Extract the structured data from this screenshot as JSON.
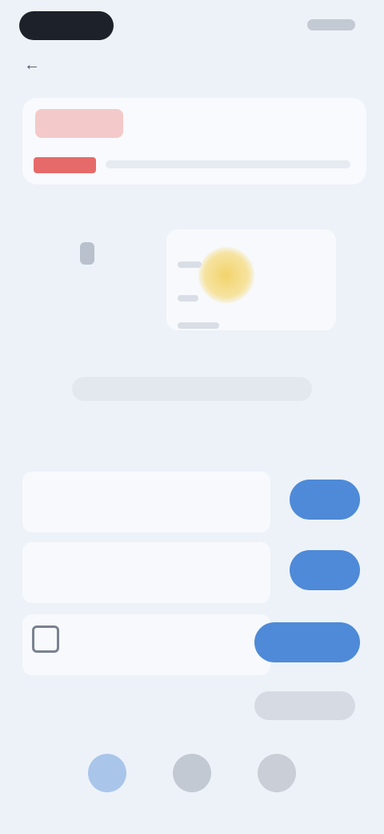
{
  "summary": {
    "title": "",
    "link": ""
  },
  "weather": {
    "left_label": ""
  },
  "section": {
    "title": ""
  },
  "rows": [
    {
      "label": "",
      "sub": "",
      "button": ""
    },
    {
      "label": "",
      "sub": "",
      "button": ""
    },
    {
      "label": "",
      "sub": "",
      "button": ""
    }
  ],
  "footer": {
    "label": "",
    "button": ""
  },
  "icons": {
    "back": "back-arrow-icon",
    "sun": "sun-icon",
    "calendar": "calendar-icon",
    "home": "home-icon",
    "search": "search-icon",
    "profile": "profile-icon"
  },
  "colors": {
    "background": "#edf2f9",
    "accent": "#4e8ad8",
    "alert": "#e66a6a",
    "sun": "#f2d36b"
  }
}
